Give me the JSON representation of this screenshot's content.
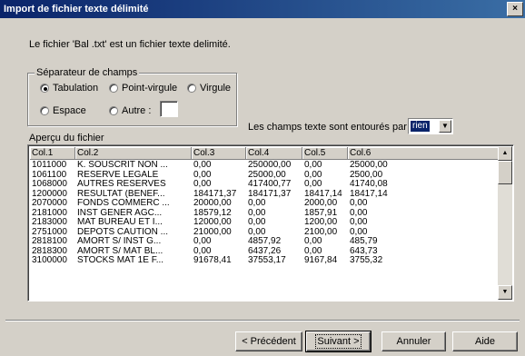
{
  "window": {
    "title": "Import de fichier texte délimité",
    "close_glyph": "×"
  },
  "info_text": "Le fichier 'Bal .txt' est un fichier texte delimité.",
  "separator_group": {
    "legend": "Séparateur de champs",
    "options": [
      {
        "label": "Tabulation",
        "checked": true
      },
      {
        "label": "Point-virgule",
        "checked": false
      },
      {
        "label": "Virgule",
        "checked": false
      },
      {
        "label": "Espace",
        "checked": false
      },
      {
        "label": "Autre :",
        "checked": false
      }
    ],
    "autre_value": ""
  },
  "qualifier": {
    "label": "Les champs texte sont entourés par",
    "value": "rien"
  },
  "preview": {
    "label": "Aperçu du fichier",
    "columns": [
      "Col.1",
      "Col.2",
      "Col.3",
      "Col.4",
      "Col.5",
      "Col.6"
    ],
    "rows": [
      [
        "1011000",
        "K. SOUSCRIT NON ...",
        "0,00",
        "250000,00",
        "0,00",
        "25000,00"
      ],
      [
        "1061100",
        "RESERVE LEGALE",
        "0,00",
        "25000,00",
        "0,00",
        "2500,00"
      ],
      [
        "1068000",
        "AUTRES RESERVES",
        "0,00",
        "417400,77",
        "0,00",
        "41740,08"
      ],
      [
        "1200000",
        "RESULTAT (BENEF...",
        "184171,37",
        "184171,37",
        "18417,14",
        "18417,14"
      ],
      [
        "2070000",
        "FONDS COMMERC ...",
        "20000,00",
        "0,00",
        "2000,00",
        "0,00"
      ],
      [
        "2181000",
        "INST GENER AGC...",
        "18579,12",
        "0,00",
        "1857,91",
        "0,00"
      ],
      [
        "2183000",
        "MAT BUREAU ET I...",
        "12000,00",
        "0,00",
        "1200,00",
        "0,00"
      ],
      [
        "2751000",
        "DEPOTS CAUTION ...",
        "21000,00",
        "0,00",
        "2100,00",
        "0,00"
      ],
      [
        "2818100",
        "AMORT S/ INST G...",
        "0,00",
        "4857,92",
        "0,00",
        "485,79"
      ],
      [
        "2818300",
        "AMORT S/ MAT BL...",
        "0,00",
        "6437,26",
        "0,00",
        "643,73"
      ],
      [
        "3100000",
        "STOCKS MAT 1E F...",
        "91678,41",
        "37553,17",
        "9167,84",
        "3755,32"
      ]
    ]
  },
  "buttons": {
    "previous": "< Précédent",
    "next": "Suivant >",
    "cancel": "Annuler",
    "help": "Aide"
  }
}
